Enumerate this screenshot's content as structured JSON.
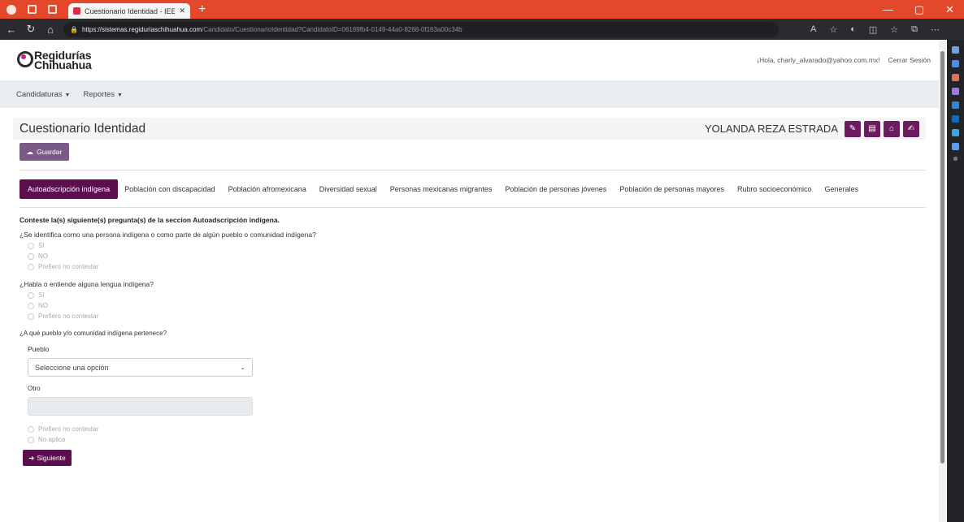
{
  "browser": {
    "tab_title": "Cuestionario Identidad - IEECon",
    "new_tab": "+",
    "url_host": "https://sistemas.regiduriaschihuahua.com",
    "url_path": "/Candidato/CuestionarioIdentidad?CandidatoID=06169fb4-0149-44a0-8268-0f163a00c34b",
    "win_min": "—",
    "win_max": "▢",
    "win_close": "✕"
  },
  "header": {
    "logo_line1": "Regidurías",
    "logo_line2": "Chihuahua",
    "greeting": "¡Hola, charly_alvarado@yahoo.com.mx!",
    "logout": "Cerrar Sesión"
  },
  "menu": {
    "items": [
      {
        "label": "Candidaturas"
      },
      {
        "label": "Reportes"
      }
    ]
  },
  "titlebar": {
    "title": "Cuestionario Identidad",
    "name": "YOLANDA REZA ESTRADA"
  },
  "save_label": "Guardar",
  "tabs": [
    {
      "label": "Autoadscripción indígena"
    },
    {
      "label": "Población con discapacidad"
    },
    {
      "label": "Población afromexicana"
    },
    {
      "label": "Diversidad sexual"
    },
    {
      "label": "Personas mexicanas migrantes"
    },
    {
      "label": "Población de personas jóvenes"
    },
    {
      "label": "Población de personas mayores"
    },
    {
      "label": "Rubro socioeconómico"
    },
    {
      "label": "Generales"
    }
  ],
  "section": {
    "intro": "Conteste la(s) siguiente(s) pregunta(s) de la seccion Autoadscripción indígena.",
    "q1": "¿Se identifica como una persona indígena o como parte de algún pueblo o comunidad indígena?",
    "q2": "¿Habla o entiende alguna lengua indígena?",
    "q3": "¿A qué pueblo y/o comunidad indígena pertenece?",
    "options": [
      "SI",
      "NO",
      "Prefiero no contestar"
    ],
    "pueblo_label": "Pueblo",
    "pueblo_selected": "Seleccione una opción",
    "otro_label": "Otro",
    "otro_value": "",
    "extra_opt1": "Prefiero no contestar",
    "extra_opt2": "No aplica",
    "next_label": "Siguiente"
  },
  "colors": {
    "browser_accent": "#e4482a",
    "primary": "#5c0f4f",
    "save_button": "#7a5a86",
    "menu_bg": "#e8edf1"
  }
}
